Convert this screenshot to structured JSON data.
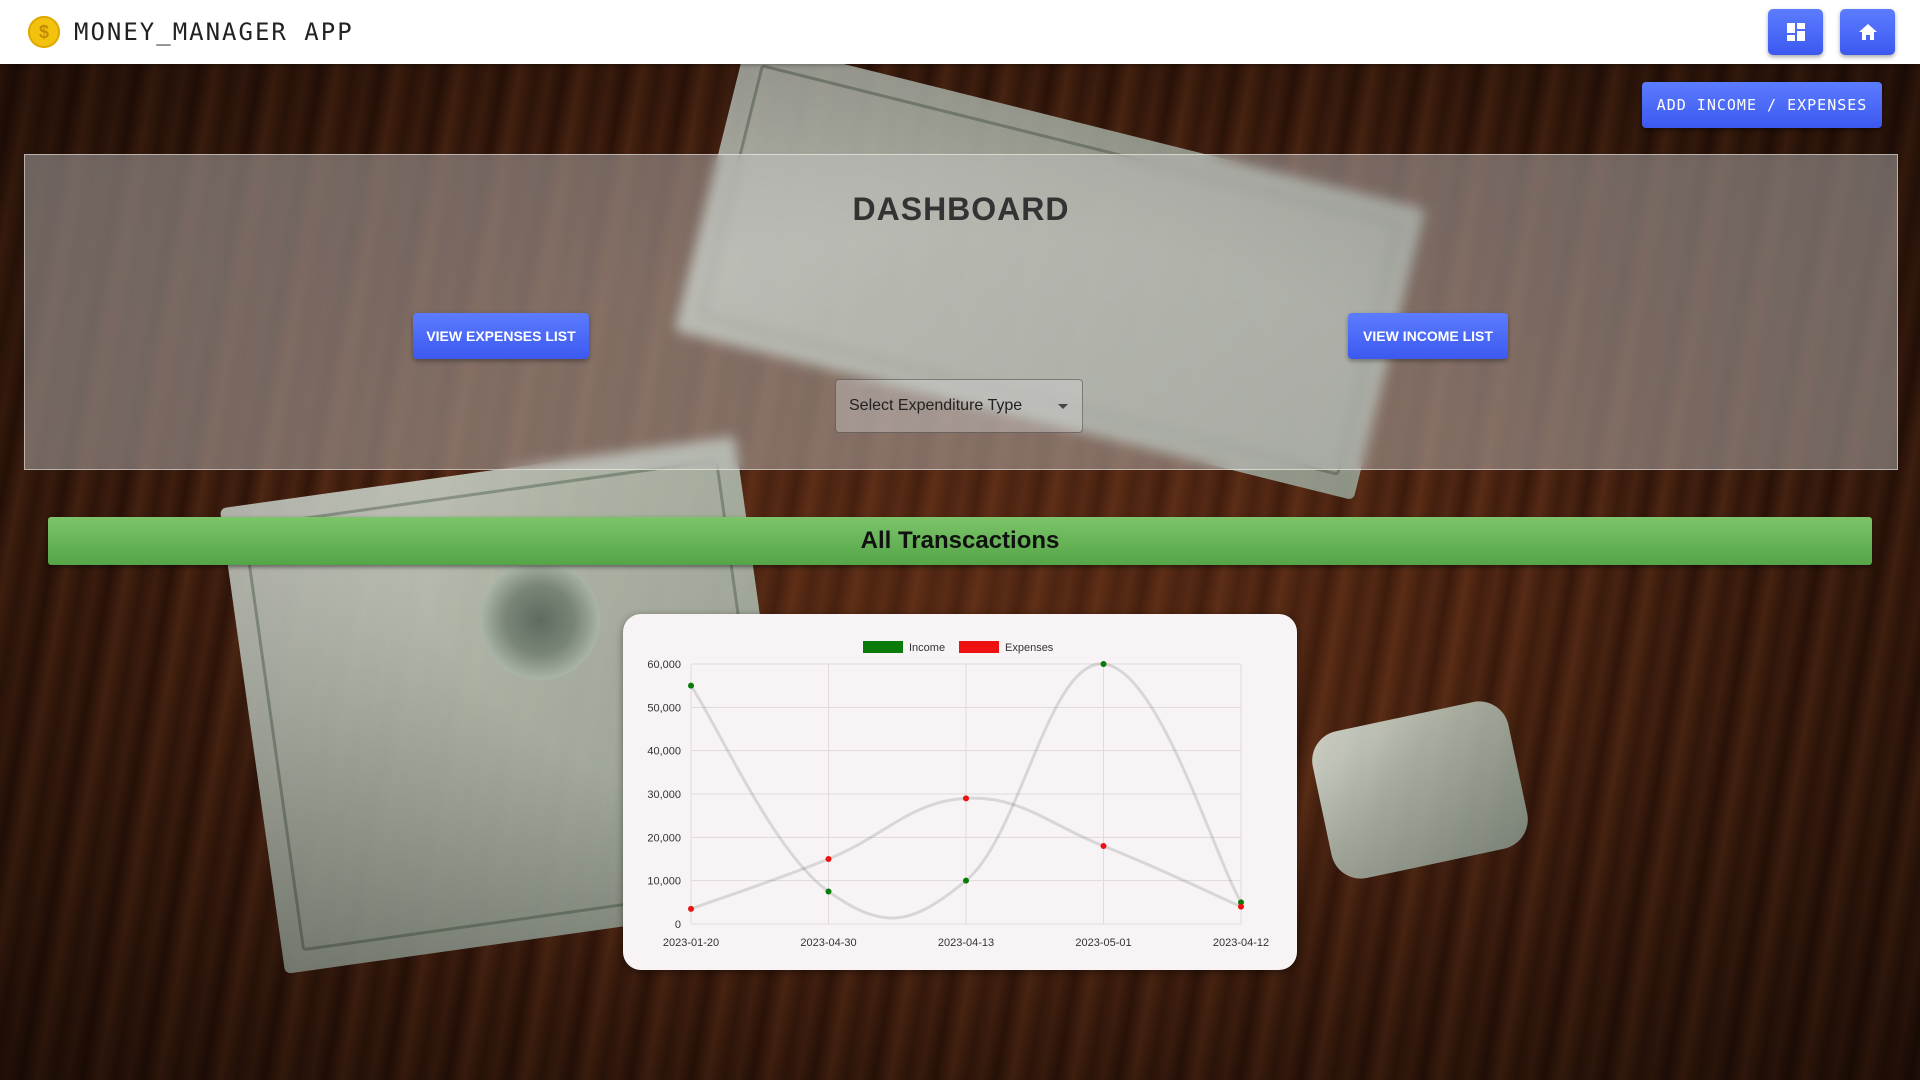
{
  "header": {
    "app_title": "MONEY_MANAGER APP",
    "logo_glyph": "$",
    "dashboard_icon": "dashboard-grid-icon",
    "home_icon": "home-icon"
  },
  "actions": {
    "add_label": "ADD INCOME / EXPENSES"
  },
  "dashboard": {
    "title": "DASHBOARD",
    "view_expenses_label": "VIEW EXPENSES LIST",
    "view_income_label": "VIEW INCOME LIST",
    "select_placeholder": "Select Expenditure Type"
  },
  "transactions": {
    "title": "All Transcactions"
  },
  "colors": {
    "accent": "#4a6bfa",
    "income": "#0a7a0a",
    "expenses": "#ee1111",
    "section": "#66b559"
  },
  "chart_data": {
    "type": "line",
    "categories": [
      "2023-01-20",
      "2023-04-30",
      "2023-04-13",
      "2023-05-01",
      "2023-04-12"
    ],
    "series": [
      {
        "name": "Income",
        "values": [
          55000,
          7500,
          10000,
          60000,
          5000
        ]
      },
      {
        "name": "Expenses",
        "values": [
          3500,
          15000,
          29000,
          18000,
          4000
        ]
      }
    ],
    "ylim": [
      0,
      60000
    ],
    "yticks": [
      0,
      10000,
      20000,
      30000,
      40000,
      50000,
      60000
    ],
    "ytick_labels": [
      "0",
      "10,000",
      "20,000",
      "30,000",
      "40,000",
      "50,000",
      "60,000"
    ],
    "legend": "top-center",
    "grid": true
  }
}
